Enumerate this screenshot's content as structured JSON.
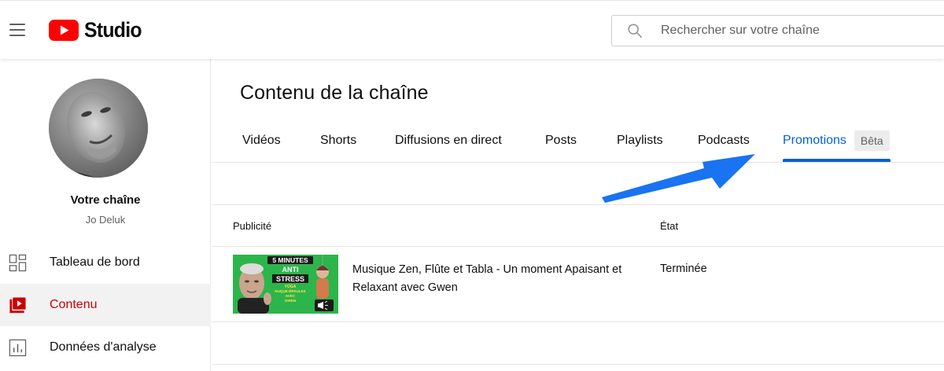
{
  "app": {
    "logo_text": "Studio",
    "brand_color": "#ff0000"
  },
  "search": {
    "placeholder": "Rechercher sur votre chaîne"
  },
  "sidebar": {
    "channel_title": "Votre chaîne",
    "channel_handle": "Jo Deluk",
    "items": [
      {
        "label": "Tableau de bord",
        "icon": "dashboard-icon",
        "active": false
      },
      {
        "label": "Contenu",
        "icon": "content-icon",
        "active": true
      },
      {
        "label": "Données d'analyse",
        "icon": "analytics-icon",
        "active": false
      }
    ]
  },
  "main": {
    "title": "Contenu de la chaîne",
    "tabs": [
      {
        "label": "Vidéos"
      },
      {
        "label": "Shorts"
      },
      {
        "label": "Diffusions en direct"
      },
      {
        "label": "Posts"
      },
      {
        "label": "Playlists"
      },
      {
        "label": "Podcasts"
      },
      {
        "label": "Promotions",
        "active": true,
        "badge": "Bêta"
      }
    ],
    "active_color": "#065fd4",
    "table": {
      "columns": [
        "Publicité",
        "État"
      ],
      "rows": [
        {
          "thumbnail": {
            "line1": "5 MINUTES",
            "line2": "ANTI",
            "line3": "STRESS",
            "sub1": "YOGA",
            "sub2": "NUQUE-ÉPAULES",
            "sub3": "AVEC",
            "sub4": "GWEN"
          },
          "title": "Musique Zen, Flûte et Tabla - Un moment Apaisant et Relaxant avec Gwen",
          "status": "Terminée"
        }
      ]
    }
  },
  "annotation": {
    "arrow_color": "#1a73f0"
  }
}
